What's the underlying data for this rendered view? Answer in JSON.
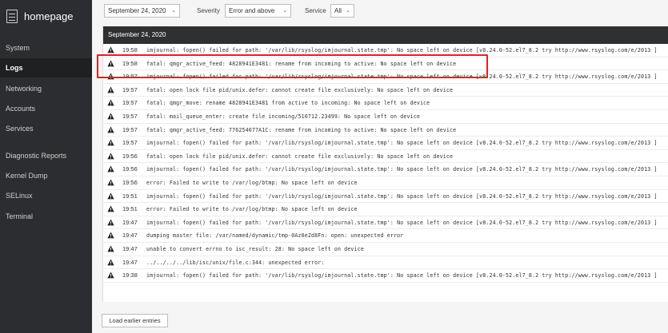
{
  "sidebar": {
    "brand": "homepage",
    "items": [
      {
        "label": "System",
        "active": false
      },
      {
        "label": "Logs",
        "active": true
      },
      {
        "label": "Networking",
        "active": false
      },
      {
        "label": "Accounts",
        "active": false
      },
      {
        "label": "Services",
        "active": false
      },
      {
        "label": "Diagnostic Reports",
        "active": false
      },
      {
        "label": "Kernel Dump",
        "active": false
      },
      {
        "label": "SELinux",
        "active": false
      },
      {
        "label": "Terminal",
        "active": false
      }
    ]
  },
  "toolbar": {
    "date_value": "September 24, 2020",
    "severity_label": "Severity",
    "severity_value": "Error and above",
    "service_label": "Service",
    "service_value": "All",
    "caret": "⌄"
  },
  "log": {
    "date_header": "September 24, 2020",
    "entries": [
      {
        "time": "19:58",
        "message": "imjournal: fopen() failed for path: '/var/lib/rsyslog/imjournal.state.tmp': No space left on device [v8.24.0-52.el7_8.2 try http://www.rsyslog.com/e/2013 ]"
      },
      {
        "time": "19:58",
        "message": "fatal: qmgr_active_feed: 4828941E3481: rename from incoming to active: No space left on device"
      },
      {
        "time": "19:57",
        "message": "imjournal: fopen() failed for path: '/var/lib/rsyslog/imjournal.state.tmp': No space left on device [v8.24.0-52.el7_8.2 try http://www.rsyslog.com/e/2013 ]"
      },
      {
        "time": "19:57",
        "message": "fatal: open lock file pid/unix.defer: cannot create file exclusively: No space left on device"
      },
      {
        "time": "19:57",
        "message": "fatal: qmgr_move: rename 4828941E3481 from active to incoming: No space left on device"
      },
      {
        "time": "19:57",
        "message": "fatal: mail_queue_enter: create file incoming/510712.23499: No space left on device"
      },
      {
        "time": "19:57",
        "message": "fatal: qmgr_active_feed: 776254077A1C: rename from incoming to active: No space left on device"
      },
      {
        "time": "19:57",
        "message": "imjournal: fopen() failed for path: '/var/lib/rsyslog/imjournal.state.tmp': No space left on device [v8.24.0-52.el7_8.2 try http://www.rsyslog.com/e/2013 ]"
      },
      {
        "time": "19:56",
        "message": "fatal: open lock file pid/unix.defer: cannot create file exclusively: No space left on device"
      },
      {
        "time": "19:56",
        "message": "imjournal: fopen() failed for path: '/var/lib/rsyslog/imjournal.state.tmp': No space left on device [v8.24.0-52.el7_8.2 try http://www.rsyslog.com/e/2013 ]"
      },
      {
        "time": "19:56",
        "message": "error: Failed to write to /var/log/btmp: No space left on device"
      },
      {
        "time": "19:51",
        "message": "imjournal: fopen() failed for path: '/var/lib/rsyslog/imjournal.state.tmp': No space left on device [v8.24.0-52.el7_8.2 try http://www.rsyslog.com/e/2013 ]"
      },
      {
        "time": "19:51",
        "message": "error: Failed to write to /var/log/btmp: No space left on device"
      },
      {
        "time": "19:47",
        "message": "imjournal: fopen() failed for path: '/var/lib/rsyslog/imjournal.state.tmp': No space left on device [v8.24.0-52.el7_8.2 try http://www.rsyslog.com/e/2013 ]"
      },
      {
        "time": "19:47",
        "message": "dumping master file: /var/named/dynamic/tmp-0Az0e2d8Fn: open: unexpected error"
      },
      {
        "time": "19:47",
        "message": "unable to convert errno to isc_result: 28: No space left on device"
      },
      {
        "time": "19:47",
        "message": "../../../../lib/isc/unix/file.c:344: unexpected error:"
      },
      {
        "time": "19:38",
        "message": "imjournal: fopen() failed for path: '/var/lib/rsyslog/imjournal.state.tmp': No space left on device [v8.24.0-52.el7_8.2 try http://www.rsyslog.com/e/2013 ]"
      }
    ]
  },
  "load_more_label": "Load earlier entries",
  "colors": {
    "sidebar_bg": "#2b2d30",
    "header_bg": "#2f3032",
    "highlight": "#e32020"
  }
}
